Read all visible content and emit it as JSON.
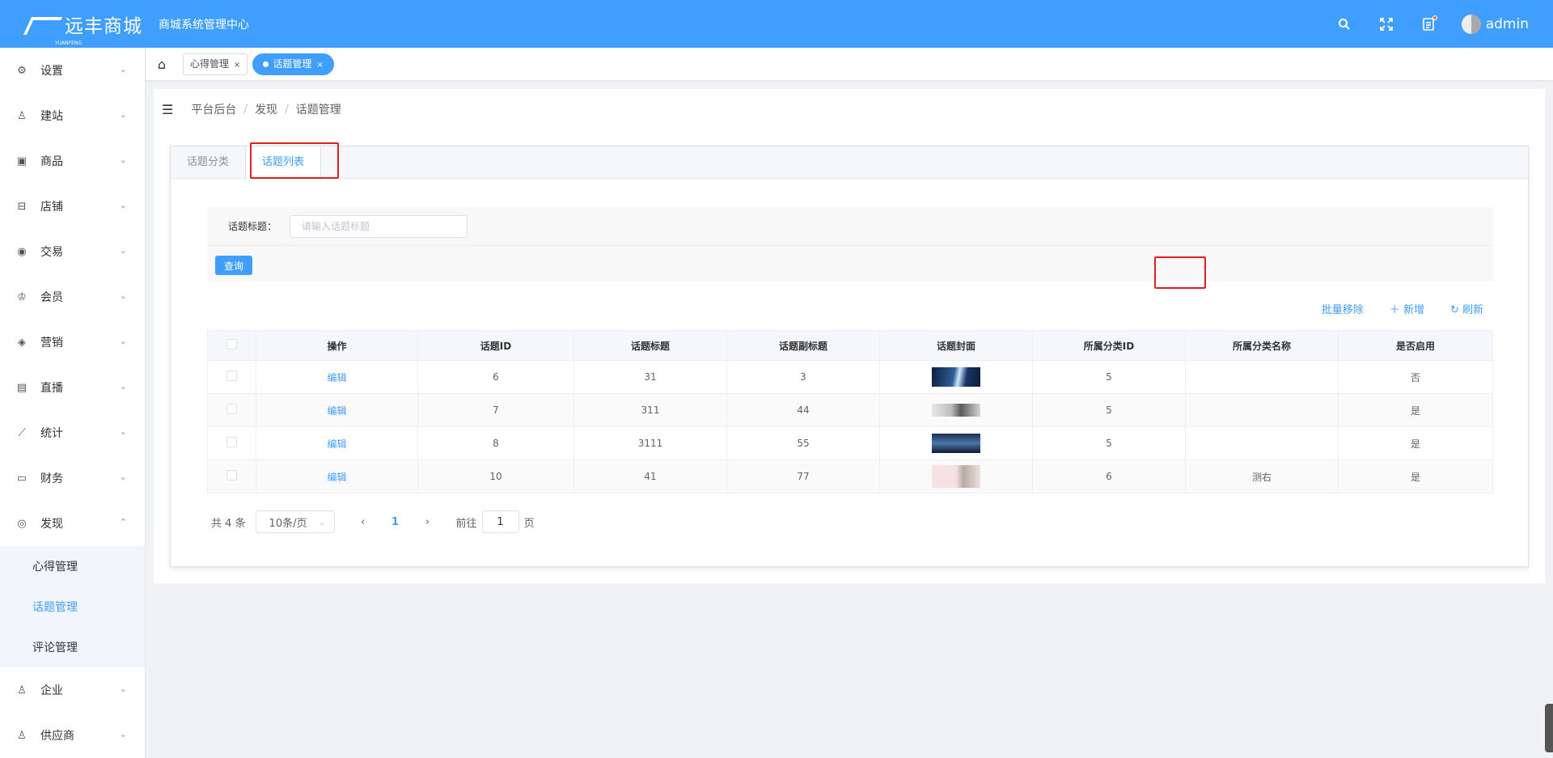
{
  "header": {
    "brand": "远丰商城",
    "brand_sub": "YUANFENG",
    "system_title": "商城系统管理中心",
    "username": "admin"
  },
  "sidebar": {
    "items": [
      {
        "label": "设置",
        "icon": "gear-icon"
      },
      {
        "label": "建站",
        "icon": "site-icon"
      },
      {
        "label": "商品",
        "icon": "goods-icon"
      },
      {
        "label": "店铺",
        "icon": "store-icon"
      },
      {
        "label": "交易",
        "icon": "trade-icon"
      },
      {
        "label": "会员",
        "icon": "member-icon"
      },
      {
        "label": "营销",
        "icon": "tag-icon"
      },
      {
        "label": "直播",
        "icon": "live-icon"
      },
      {
        "label": "统计",
        "icon": "chart-icon"
      },
      {
        "label": "财务",
        "icon": "wallet-icon"
      },
      {
        "label": "发现",
        "icon": "compass-icon"
      }
    ],
    "discover_sub": [
      "心得管理",
      "话题管理",
      "评论管理"
    ],
    "bottom_items": [
      {
        "label": "企业",
        "icon": "company-icon"
      },
      {
        "label": "供应商",
        "icon": "supplier-icon"
      }
    ]
  },
  "tabsbar": {
    "tabs": [
      "心得管理",
      "话题管理"
    ],
    "close": "×"
  },
  "breadcrumb": [
    "平台后台",
    "发现",
    "话题管理"
  ],
  "content_tabs": [
    "话题分类",
    "话题列表"
  ],
  "search": {
    "label": "话题标题：",
    "placeholder": "请输入话题标题",
    "button": "查询"
  },
  "toolbar": {
    "batch_remove": "批量移除",
    "add": "新增",
    "refresh": "刷新"
  },
  "table": {
    "headers": [
      "操作",
      "话题ID",
      "话题标题",
      "话题副标题",
      "话题封面",
      "所属分类ID",
      "所属分类名称",
      "是否启用"
    ],
    "rows": [
      {
        "action": "编辑",
        "id": "6",
        "title": "31",
        "subtitle": "3",
        "cover": "dark-blue",
        "cat_id": "5",
        "cat_name": "",
        "enabled": "否"
      },
      {
        "action": "编辑",
        "id": "7",
        "title": "311",
        "subtitle": "44",
        "cover": "grey",
        "cat_id": "5",
        "cat_name": "",
        "enabled": "是"
      },
      {
        "action": "编辑",
        "id": "8",
        "title": "3111",
        "subtitle": "55",
        "cover": "mountain",
        "cat_id": "5",
        "cat_name": "",
        "enabled": "是"
      },
      {
        "action": "编辑",
        "id": "10",
        "title": "41",
        "subtitle": "77",
        "cover": "pink",
        "cat_id": "6",
        "cat_name": "测右",
        "enabled": "是"
      }
    ]
  },
  "pagination": {
    "total": "共 4 条",
    "page_size": "10条/页",
    "current": "1",
    "goto_prefix": "前往",
    "goto_value": "1",
    "goto_suffix": "页"
  },
  "colors": {
    "primary": "#409eff",
    "highlight_box": "#e02020"
  }
}
